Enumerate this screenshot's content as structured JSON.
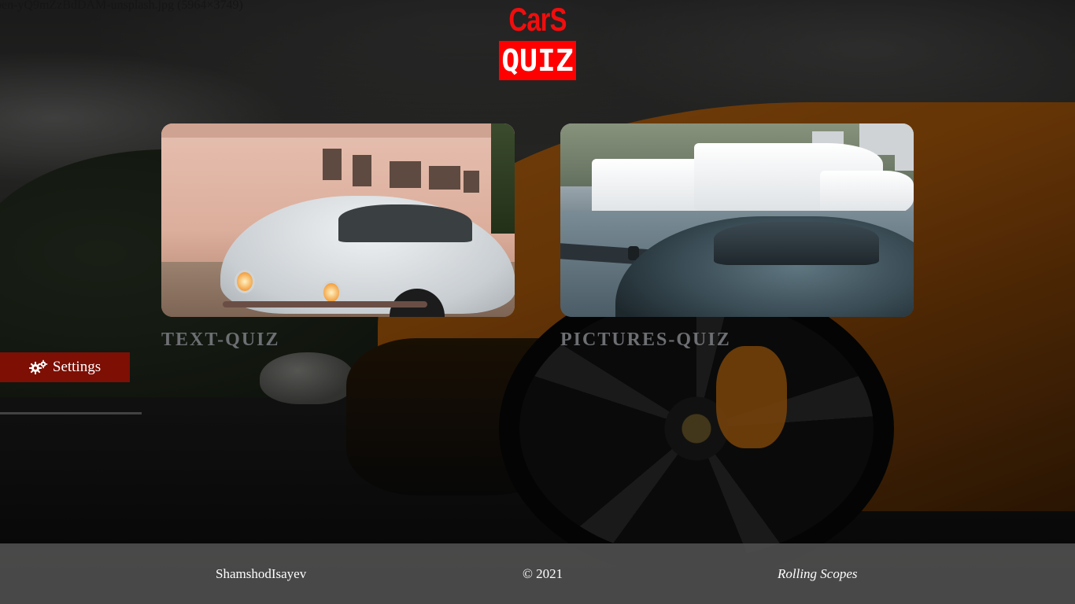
{
  "filename_text": "pen-yQ9mZzBdDAM-unsplash.jpg (5964×3749)",
  "logo": {
    "cars": "CarS",
    "quiz": "QUIZ",
    "colors": {
      "cars_text": "#f20d0d",
      "quiz_bg": "#ff0000"
    }
  },
  "quizzes": [
    {
      "label": "TEXT-QUIZ",
      "image": "white-beetle-car-photo"
    },
    {
      "label": "PICTURES-QUIZ",
      "image": "dark-sports-car-with-yachts-photo"
    }
  ],
  "settings": {
    "label": "Settings",
    "icon": "gears-icon",
    "bg_color": "#7d0f05"
  },
  "footer": {
    "author": "ShamshodIsayev",
    "copyright": "© 2021",
    "school": "Rolling Scopes"
  }
}
